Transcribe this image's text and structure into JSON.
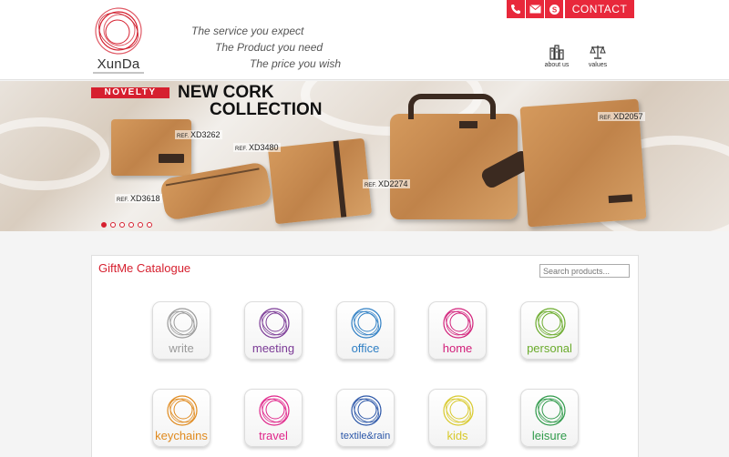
{
  "header": {
    "logo_text": "XunDa",
    "taglines": [
      "The service you expect",
      "The Product you need",
      "The price you wish"
    ],
    "contact_icons": [
      "phone-icon",
      "mail-icon",
      "skype-icon"
    ],
    "contact_label": "CONTACT",
    "about_label": "about us",
    "values_label": "values"
  },
  "banner": {
    "novelty_label": "NOVELTY",
    "headline_line1": "NEW CORK",
    "headline_line2": "COLLECTION",
    "ref_prefix": "REF.",
    "refs": [
      "XD3262",
      "XD3480",
      "XD3618",
      "XD2274",
      "XD2057"
    ],
    "slide_count": 6,
    "active_slide": 1
  },
  "catalogue": {
    "title": "GiftMe Catalogue",
    "search_placeholder": "Search products...",
    "categories": [
      {
        "label": "write",
        "color": "#9a9a9a"
      },
      {
        "label": "meeting",
        "color": "#7b3a96"
      },
      {
        "label": "office",
        "color": "#2f7fc4"
      },
      {
        "label": "home",
        "color": "#d2207a"
      },
      {
        "label": "personal",
        "color": "#6aab2b"
      },
      {
        "label": "keychains",
        "color": "#e08a1e"
      },
      {
        "label": "travel",
        "color": "#e0258a"
      },
      {
        "label": "textile&rain",
        "color": "#2b56a8"
      },
      {
        "label": "kids",
        "color": "#d8c92b"
      },
      {
        "label": "leisure",
        "color": "#2f9a4a"
      }
    ]
  },
  "colors": {
    "accent": "#e8283b",
    "brand_red": "#d6202f"
  }
}
